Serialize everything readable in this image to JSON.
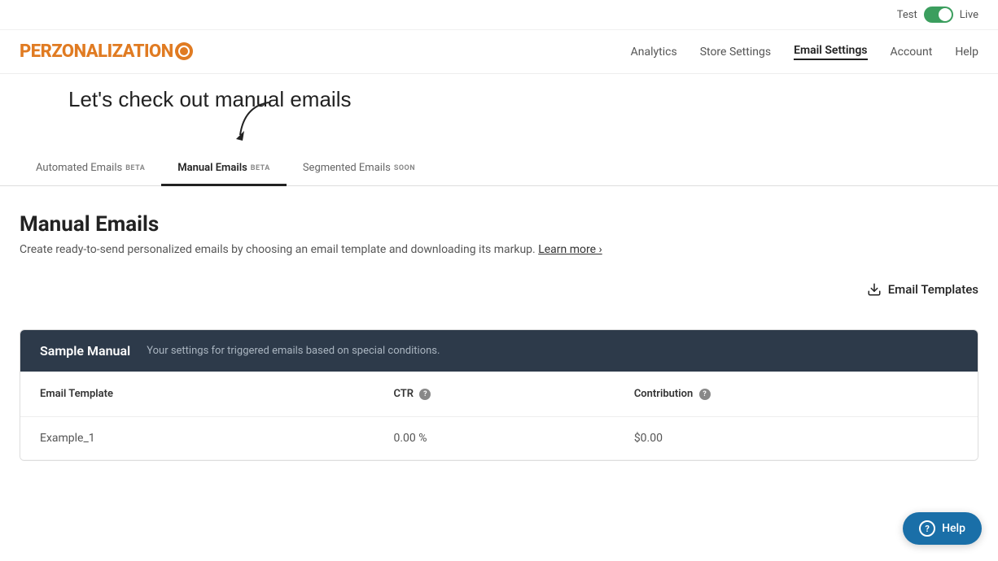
{
  "topBar": {
    "testLabel": "Test",
    "liveLabel": "Live"
  },
  "header": {
    "logoText": "PERZONALIZATION",
    "nav": [
      {
        "label": "Analytics",
        "active": false
      },
      {
        "label": "Store Settings",
        "active": false
      },
      {
        "label": "Email Settings",
        "active": true
      },
      {
        "label": "Account",
        "active": false
      },
      {
        "label": "Help",
        "active": false
      }
    ]
  },
  "annotation": {
    "text": "Let's check out manual emails"
  },
  "tabs": [
    {
      "label": "Automated Emails",
      "badge": "BETA",
      "active": false
    },
    {
      "label": "Manual Emails",
      "badge": "BETA",
      "active": true
    },
    {
      "label": "Segmented Emails",
      "badge": "SOON",
      "active": false
    }
  ],
  "main": {
    "pageTitle": "Manual Emails",
    "pageDescription": "Create ready-to-send personalized emails by choosing an email template and downloading its markup.",
    "learnMoreLabel": "Learn more ›",
    "emailTemplatesLabel": "Email Templates",
    "card": {
      "title": "Sample Manual",
      "description": "Your settings for triggered emails based on special conditions.",
      "tableHeaders": [
        "Email Template",
        "CTR",
        "Contribution"
      ],
      "tableRows": [
        {
          "emailTemplate": "Example_1",
          "ctr": "0.00 %",
          "contribution": "$0.00"
        }
      ]
    }
  },
  "helpButton": {
    "label": "Help"
  }
}
